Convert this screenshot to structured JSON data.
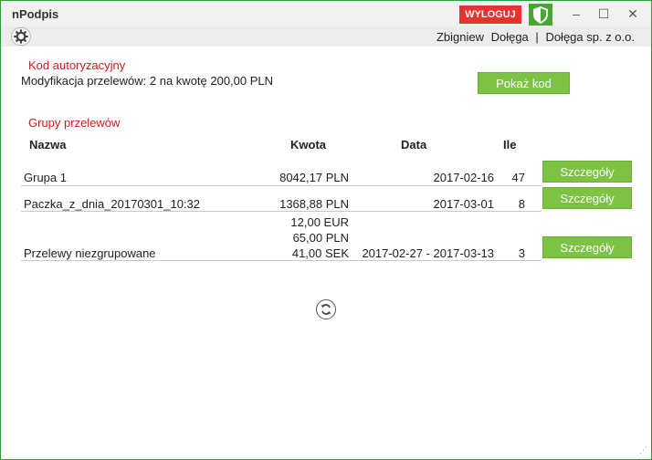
{
  "window": {
    "title": "nPodpis",
    "logout_label": "WYLOGUJ",
    "minimize": "–",
    "maximize": "☐",
    "close": "✕"
  },
  "toolbar": {
    "settings_icon": "gear-icon",
    "user_first": "Zbigniew",
    "user_last": "Dołęga",
    "separator": "|",
    "company": "Dołęga sp. z o.o."
  },
  "auth": {
    "title": "Kod autoryzacyjny",
    "description": "Modyfikacja przelewów: 2 na kwotę 200,00 PLN",
    "show_code_label": "Pokaż kod"
  },
  "groups": {
    "title": "Grupy przelewów",
    "columns": {
      "name": "Nazwa",
      "amount": "Kwota",
      "date": "Data",
      "count": "Ile"
    },
    "details_label": "Szczegóły",
    "rows": [
      {
        "name": "Grupa 1",
        "amounts": [
          "8042,17 PLN"
        ],
        "date": "2017-02-16",
        "count": "47"
      },
      {
        "name": "Paczka_z_dnia_20170301_10:32",
        "amounts": [
          "1368,88 PLN"
        ],
        "date": "2017-03-01",
        "count": "8"
      },
      {
        "name": "Przelewy niezgrupowane",
        "amounts": [
          "12,00 EUR",
          "65,00 PLN",
          "41,00 SEK"
        ],
        "date": "2017-02-27 - 2017-03-13",
        "count": "3"
      }
    ]
  },
  "refresh_icon": "refresh-icon",
  "colors": {
    "accent_green": "#7dc242",
    "logout_red": "#e8322f",
    "section_red": "#cc1f1f",
    "window_border": "#2e9f3a"
  }
}
